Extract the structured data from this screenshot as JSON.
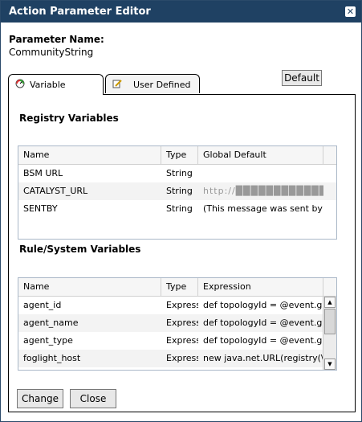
{
  "window": {
    "title": "Action Parameter Editor"
  },
  "parameter": {
    "label": "Parameter Name:",
    "value": "CommunityString"
  },
  "tabs": [
    {
      "label": "Variable",
      "icon": "gauge-icon",
      "active": true
    },
    {
      "label": "User Defined",
      "icon": "edit-icon",
      "active": false
    }
  ],
  "default_button": "Default",
  "registry": {
    "title": "Registry Variables",
    "columns": [
      "Name",
      "Type",
      "Global Default"
    ],
    "rows": [
      {
        "name": "BSM URL",
        "type": "String",
        "default": ""
      },
      {
        "name": "CATALYST_URL",
        "type": "String",
        "default": "http://██████████████e"
      },
      {
        "name": "SENTBY",
        "type": "String",
        "default": "(This message was sent by Ce"
      }
    ]
  },
  "rules": {
    "title": "Rule/System Variables",
    "columns": [
      "Name",
      "Type",
      "Expression"
    ],
    "rows": [
      {
        "name": "agent_id",
        "type": "Express",
        "expr": "def topologyId = @event.get(\\\""
      },
      {
        "name": "agent_name",
        "type": "Express",
        "expr": "def topologyId = @event.get(\\\""
      },
      {
        "name": "agent_type",
        "type": "Express",
        "expr": "def topologyId = @event.get(\\\""
      },
      {
        "name": "foglight_host",
        "type": "Express",
        "expr": "new java.net.URL(registry(\\\"C/"
      }
    ]
  },
  "buttons": {
    "change": "Change",
    "close": "Close"
  },
  "colors": {
    "titlebar": "#1f4163",
    "accent": "#2a4a6a"
  }
}
